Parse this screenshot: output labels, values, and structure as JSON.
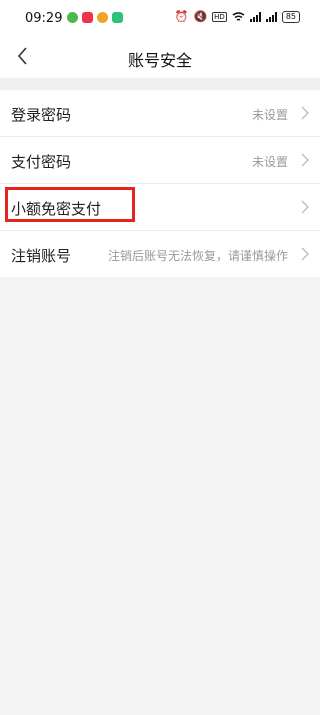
{
  "status_bar": {
    "time": "09:29",
    "battery": "85",
    "colors": {
      "app1": "#4fb74f",
      "app2": "#f0314c",
      "app3": "#f0a324",
      "app4": "#2cc27b"
    },
    "icons": [
      "wechat-icon",
      "app-icon",
      "weibo-icon",
      "app-icon",
      "alarm-icon",
      "mute-icon",
      "hd-icon",
      "wifi-icon",
      "signal-icon",
      "signal-icon",
      "battery-icon"
    ]
  },
  "header": {
    "title": "账号安全"
  },
  "menu": {
    "items": [
      {
        "label": "登录密码",
        "value": "未设置"
      },
      {
        "label": "支付密码",
        "value": "未设置"
      },
      {
        "label": "小额免密支付",
        "value": ""
      },
      {
        "label": "注销账号",
        "value": "注销后账号无法恢复，请谨慎操作"
      }
    ]
  },
  "annotation": {
    "color": "#e5241f"
  }
}
